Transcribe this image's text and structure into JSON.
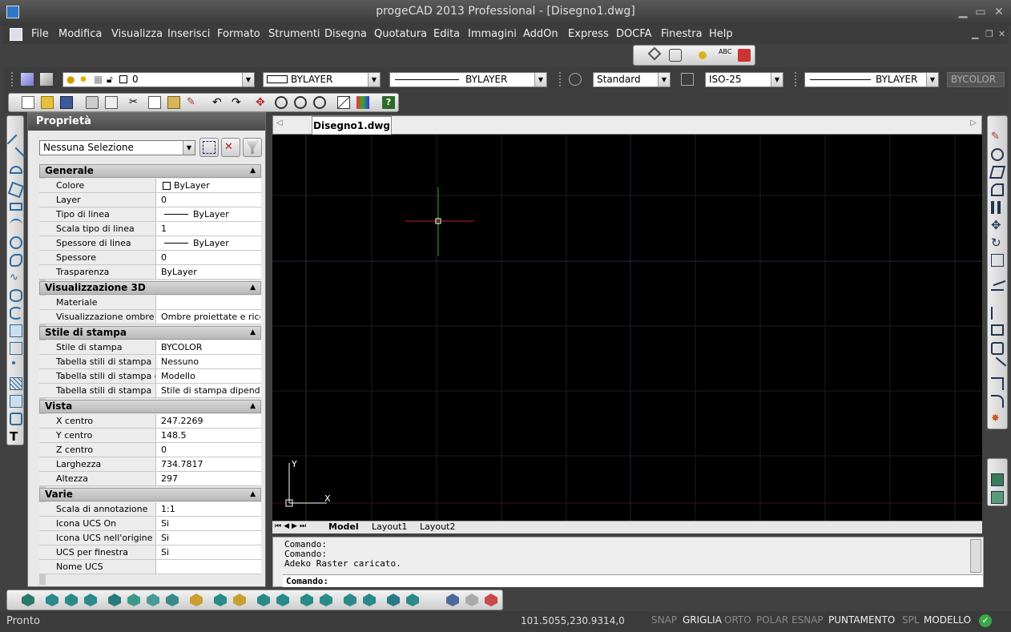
{
  "window": {
    "title": "progeCAD 2013 Professional - [Disegno1.dwg]"
  },
  "menu": [
    "File",
    "Modifica",
    "Visualizza",
    "Inserisci",
    "Formato",
    "Strumenti",
    "Disegna",
    "Quotatura",
    "Edita",
    "Immagini",
    "AddOn",
    "Express",
    "DOCFA",
    "Finestra",
    "Help"
  ],
  "toolbar": {
    "layer_value": "0",
    "color_value": "BYLAYER",
    "linetype_value": "BYLAYER",
    "text_style": "Standard",
    "dim_style": "ISO-25",
    "lineweight_value": "BYLAYER",
    "plotstyle_value": "BYCOLOR"
  },
  "properties": {
    "title": "Proprietà",
    "selection": "Nessuna Selezione",
    "sections": [
      {
        "name": "Generale",
        "rows": [
          {
            "k": "Colore",
            "v": "ByLayer"
          },
          {
            "k": "Layer",
            "v": "0"
          },
          {
            "k": "Tipo di linea",
            "v": "ByLayer"
          },
          {
            "k": "Scala tipo di linea",
            "v": "1"
          },
          {
            "k": "Spessore di linea",
            "v": "ByLayer"
          },
          {
            "k": "Spessore",
            "v": "0"
          },
          {
            "k": "Trasparenza",
            "v": "ByLayer"
          }
        ]
      },
      {
        "name": "Visualizzazione 3D",
        "rows": [
          {
            "k": "Materiale",
            "v": ""
          },
          {
            "k": "Visualizzazione ombre",
            "v": "Ombre proiettate e ricev..."
          }
        ]
      },
      {
        "name": "Stile di stampa",
        "rows": [
          {
            "k": "Stile di stampa",
            "v": "BYCOLOR"
          },
          {
            "k": "Tabella stili di stampa",
            "v": "Nessuno"
          },
          {
            "k": "Tabella stili di stampa c...",
            "v": "Modello"
          },
          {
            "k": "Tabella stili di stampa",
            "v": "Stile di stampa dipenden..."
          }
        ]
      },
      {
        "name": "Vista",
        "rows": [
          {
            "k": "X centro",
            "v": "247.2269"
          },
          {
            "k": "Y centro",
            "v": "148.5"
          },
          {
            "k": "Z centro",
            "v": "0"
          },
          {
            "k": "Larghezza",
            "v": "734.7817"
          },
          {
            "k": "Altezza",
            "v": "297"
          }
        ]
      },
      {
        "name": "Varie",
        "rows": [
          {
            "k": "Scala di annotazione",
            "v": "1:1"
          },
          {
            "k": "Icona UCS On",
            "v": "Si"
          },
          {
            "k": "Icona UCS nell'origine",
            "v": "Si"
          },
          {
            "k": "UCS per finestra",
            "v": "Si"
          },
          {
            "k": "Nome UCS",
            "v": ""
          }
        ]
      }
    ]
  },
  "drawing": {
    "tab": "Disegno1.dwg",
    "ucs_x": "X",
    "ucs_y": "Y"
  },
  "layout_tabs": [
    "Model",
    "Layout1",
    "Layout2"
  ],
  "command": {
    "history": [
      "Comando:",
      "Comando:",
      "Adeko Raster caricato."
    ],
    "prompt": "Comando:"
  },
  "status": {
    "text": "Pronto",
    "coords": "101.5055,230.9314,0",
    "toggles": [
      {
        "label": "SNAP",
        "on": false
      },
      {
        "label": "GRIGLIA",
        "on": true
      },
      {
        "label": "ORTO",
        "on": false
      },
      {
        "label": "POLAR",
        "on": false
      },
      {
        "label": "ESNAP",
        "on": false
      },
      {
        "label": "PUNTAMENTO",
        "on": true
      },
      {
        "label": "SPL",
        "on": false
      },
      {
        "label": "MODELLO",
        "on": true
      }
    ]
  }
}
